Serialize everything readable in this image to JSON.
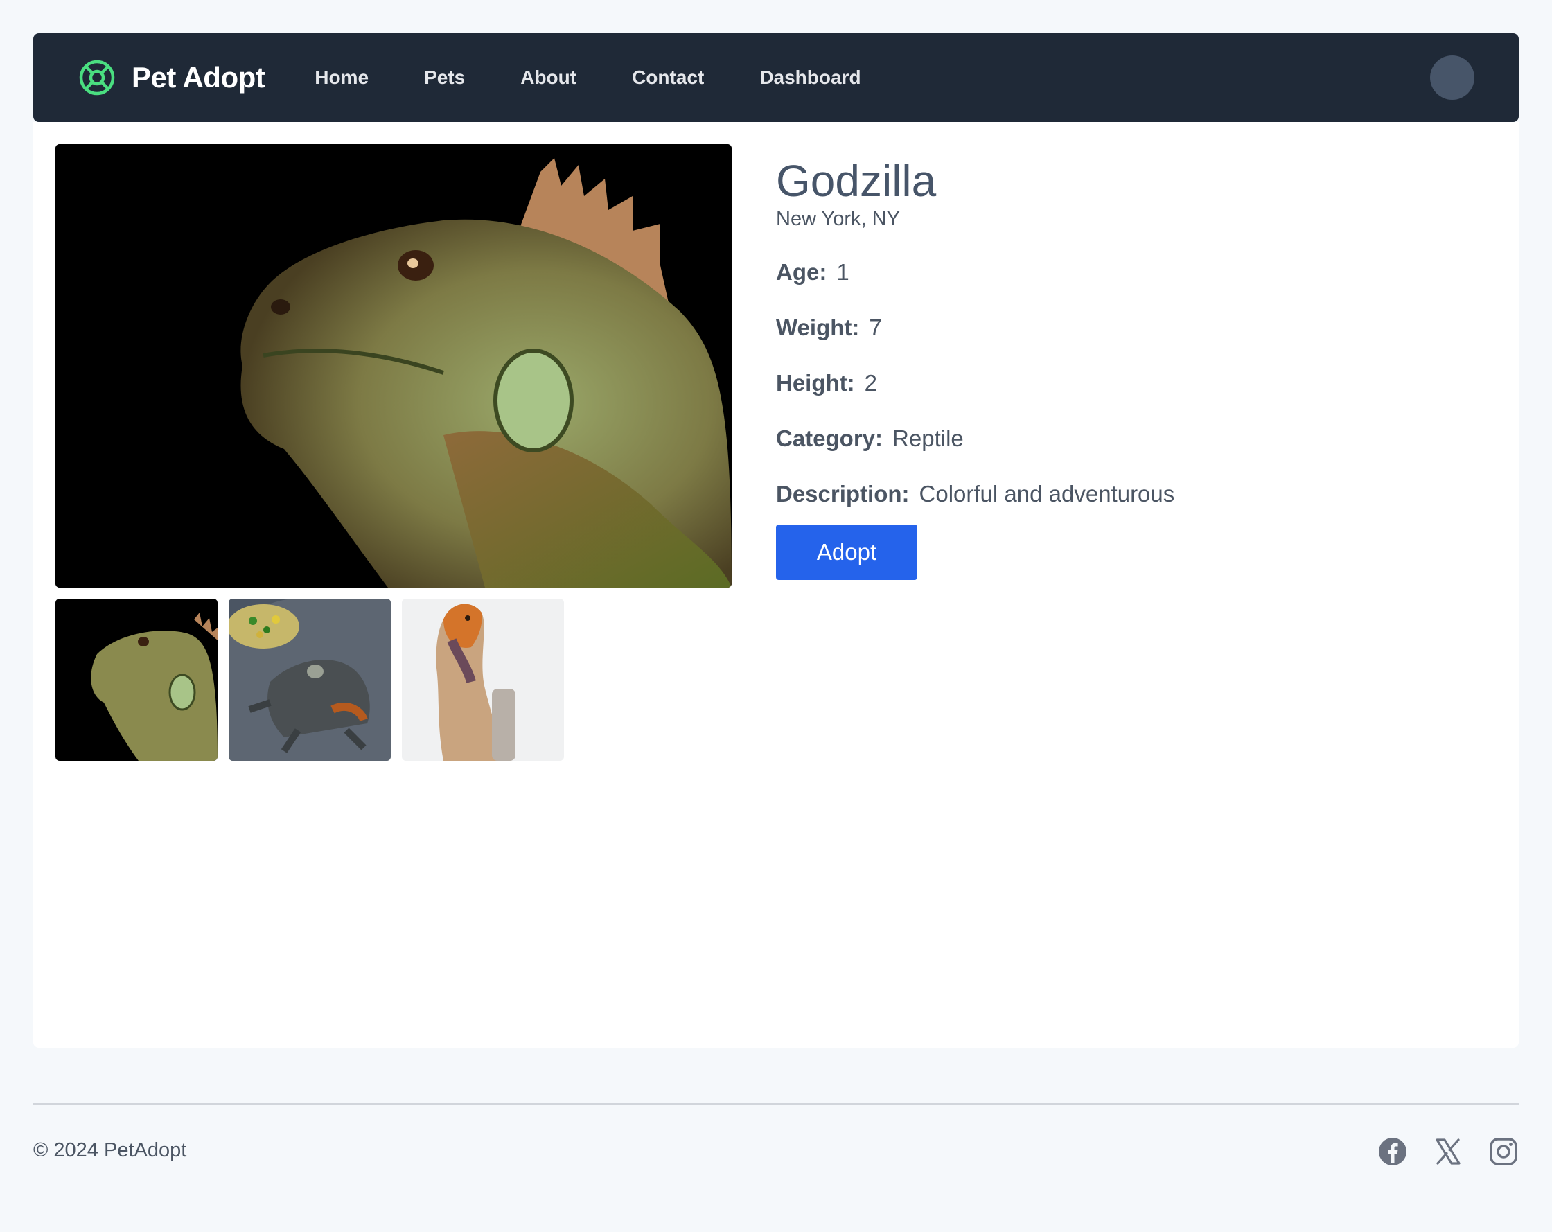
{
  "nav": {
    "brand": "Pet Adopt",
    "links": [
      "Home",
      "Pets",
      "About",
      "Contact",
      "Dashboard"
    ],
    "brand_color": "#4ade80",
    "background": "#1f2937"
  },
  "pet": {
    "name": "Godzilla",
    "location": "New York, NY",
    "age_label": "Age:",
    "age": "1",
    "weight_label": "Weight:",
    "weight": "7",
    "height_label": "Height:",
    "height": "2",
    "category_label": "Category:",
    "category": "Reptile",
    "description_label": "Description:",
    "description": "Colorful and adventurous",
    "adopt_label": "Adopt",
    "main_image_alt": "Green iguana",
    "thumbnails": [
      "iguana-closeup",
      "iguana-with-food",
      "orange-lizard"
    ]
  },
  "footer": {
    "copyright": "© 2024 PetAdopt",
    "socials": [
      "facebook-icon",
      "x-icon",
      "instagram-icon"
    ]
  },
  "colors": {
    "accent": "#2563eb",
    "page_bg": "#f5f8fb"
  }
}
